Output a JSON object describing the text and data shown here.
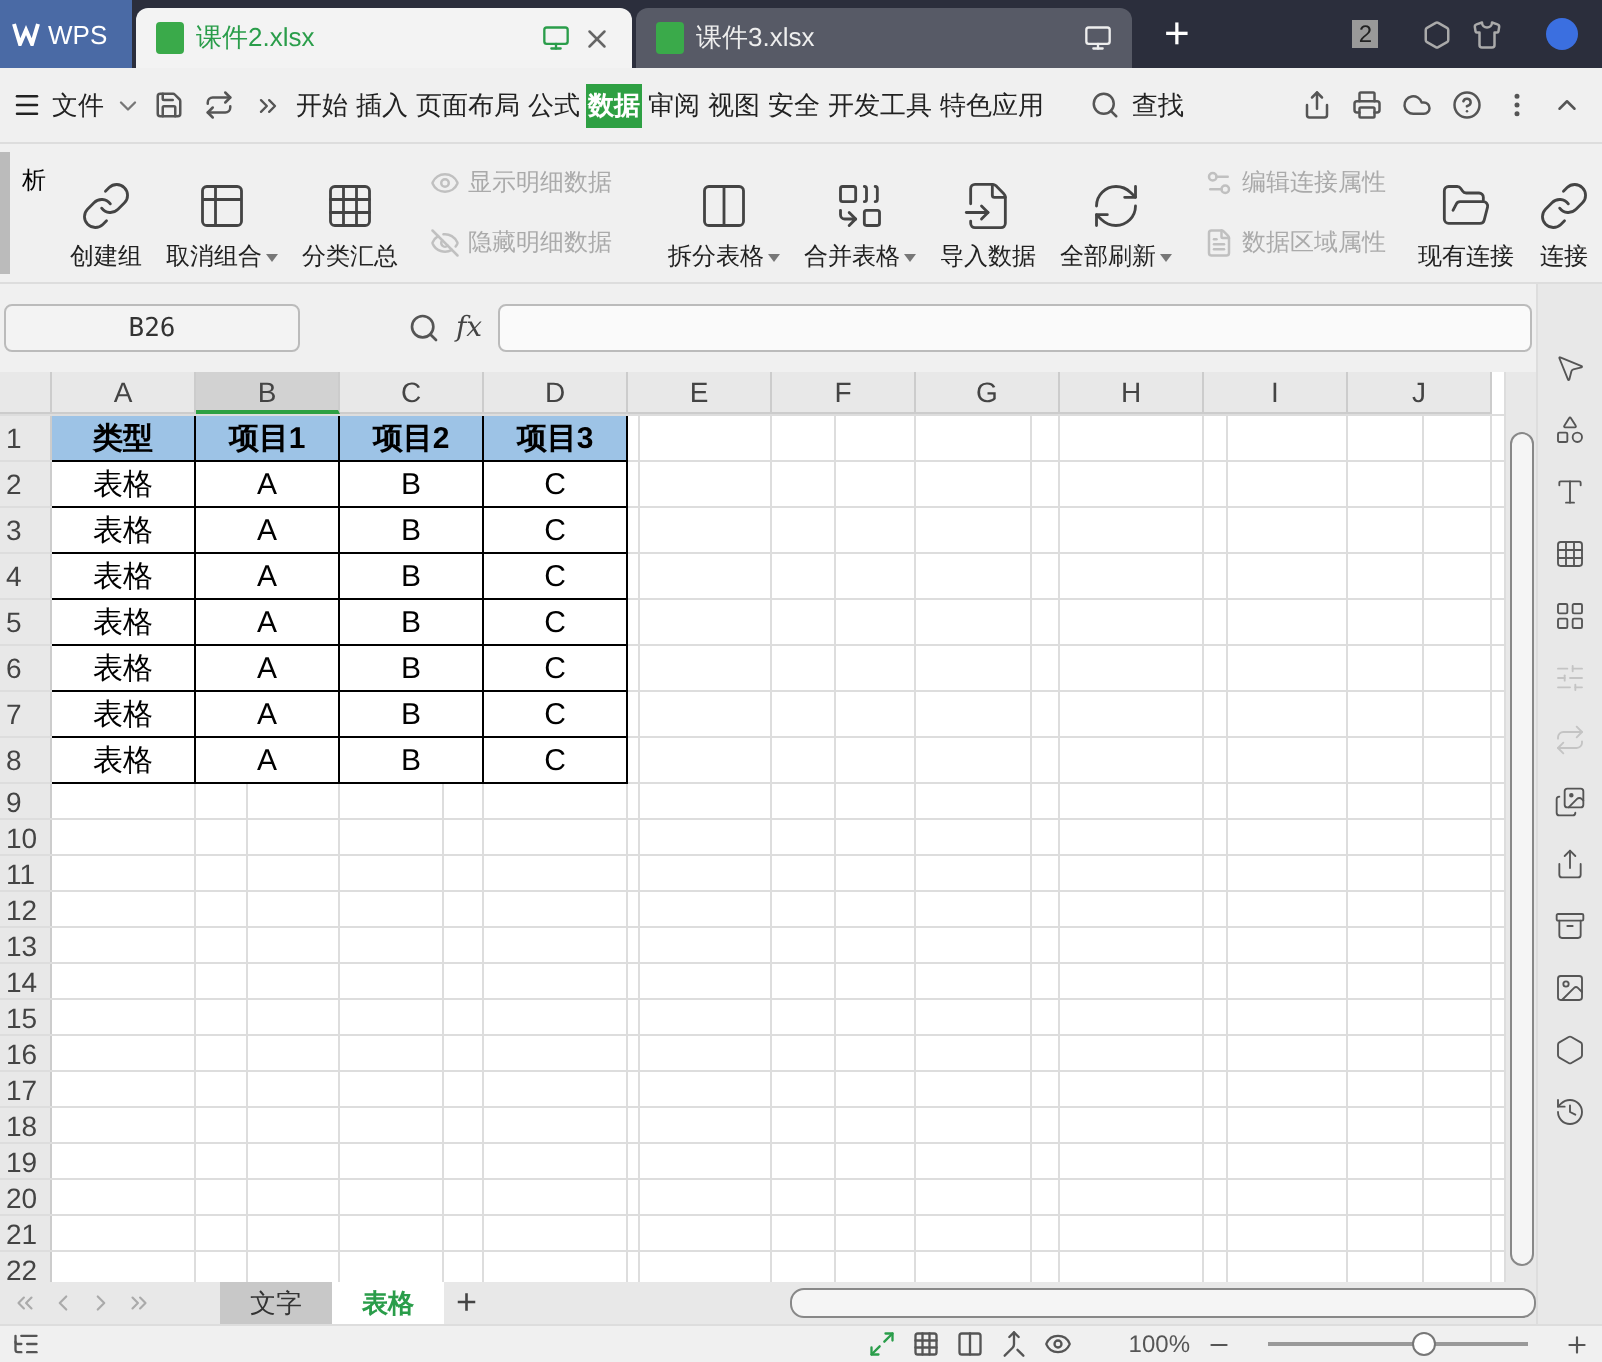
{
  "title_bar": {
    "app_tab": "WPS",
    "doc_tabs": [
      {
        "name": "课件2.xlsx",
        "selected": true
      },
      {
        "name": "课件3.xlsx",
        "selected": false
      }
    ],
    "new_tab": "+",
    "window_count": "2"
  },
  "menu": {
    "file": "文件",
    "tabs": [
      {
        "label": "开始",
        "selected": false
      },
      {
        "label": "插入",
        "selected": false
      },
      {
        "label": "页面布局",
        "selected": false
      },
      {
        "label": "公式",
        "selected": false
      },
      {
        "label": "数据",
        "selected": true
      },
      {
        "label": "审阅",
        "selected": false
      },
      {
        "label": "视图",
        "selected": false
      },
      {
        "label": "安全",
        "selected": false
      },
      {
        "label": "开发工具",
        "selected": false
      },
      {
        "label": "特色应用",
        "selected": false
      }
    ],
    "search": "查找"
  },
  "ribbon": {
    "cut_label": "析",
    "items": [
      {
        "kind": "large",
        "label": "创建组",
        "dropdown": false,
        "disabled": false
      },
      {
        "kind": "large",
        "label": "取消组合",
        "dropdown": true,
        "disabled": false
      },
      {
        "kind": "large",
        "label": "分类汇总",
        "dropdown": false,
        "disabled": false
      },
      {
        "kind": "stack",
        "entries": [
          {
            "label": "显示明细数据",
            "disabled": true
          },
          {
            "label": "隐藏明细数据",
            "disabled": true
          }
        ]
      },
      {
        "kind": "separator"
      },
      {
        "kind": "large",
        "label": "拆分表格",
        "dropdown": true,
        "disabled": false
      },
      {
        "kind": "large",
        "label": "合并表格",
        "dropdown": true,
        "disabled": false
      },
      {
        "kind": "large",
        "label": "导入数据",
        "dropdown": false,
        "disabled": false
      },
      {
        "kind": "large",
        "label": "全部刷新",
        "dropdown": true,
        "disabled": false
      },
      {
        "kind": "stack",
        "entries": [
          {
            "label": "编辑连接属性",
            "disabled": true
          },
          {
            "label": "数据区域属性",
            "disabled": true
          }
        ]
      },
      {
        "kind": "large",
        "label": "现有连接",
        "dropdown": false,
        "disabled": false
      },
      {
        "kind": "large",
        "label": "连接",
        "dropdown": false,
        "disabled": false
      }
    ]
  },
  "formula_bar": {
    "cell_ref": "B26",
    "fx": "fx"
  },
  "sheet": {
    "columns": [
      {
        "label": "A",
        "selected": false
      },
      {
        "label": "B",
        "selected": true
      },
      {
        "label": "C",
        "selected": false
      },
      {
        "label": "D",
        "selected": false
      },
      {
        "label": "E",
        "selected": false
      },
      {
        "label": "F",
        "selected": false
      },
      {
        "label": "G",
        "selected": false
      },
      {
        "label": "H",
        "selected": false
      },
      {
        "label": "I",
        "selected": false
      },
      {
        "label": "J",
        "selected": false
      }
    ],
    "rows": [
      {
        "number": "1",
        "kind": "header",
        "cells": [
          "类型",
          "项目1",
          "项目2",
          "项目3"
        ]
      },
      {
        "number": "2",
        "kind": "data",
        "cells": [
          "表格",
          "A",
          "B",
          "C"
        ]
      },
      {
        "number": "3",
        "kind": "data",
        "cells": [
          "表格",
          "A",
          "B",
          "C"
        ]
      },
      {
        "number": "4",
        "kind": "data",
        "cells": [
          "表格",
          "A",
          "B",
          "C"
        ]
      },
      {
        "number": "5",
        "kind": "data",
        "cells": [
          "表格",
          "A",
          "B",
          "C"
        ]
      },
      {
        "number": "6",
        "kind": "data",
        "cells": [
          "表格",
          "A",
          "B",
          "C"
        ]
      },
      {
        "number": "7",
        "kind": "data",
        "cells": [
          "表格",
          "A",
          "B",
          "C"
        ]
      },
      {
        "number": "8",
        "kind": "data",
        "cells": [
          "表格",
          "A",
          "B",
          "C"
        ]
      },
      {
        "number": "9",
        "kind": "empty"
      },
      {
        "number": "10",
        "kind": "empty"
      },
      {
        "number": "11",
        "kind": "empty"
      },
      {
        "number": "12",
        "kind": "empty"
      },
      {
        "number": "13",
        "kind": "empty"
      },
      {
        "number": "14",
        "kind": "empty"
      },
      {
        "number": "15",
        "kind": "empty"
      },
      {
        "number": "16",
        "kind": "empty"
      },
      {
        "number": "17",
        "kind": "empty"
      },
      {
        "number": "18",
        "kind": "empty"
      },
      {
        "number": "19",
        "kind": "empty"
      },
      {
        "number": "20",
        "kind": "empty"
      },
      {
        "number": "21",
        "kind": "empty"
      },
      {
        "number": "22",
        "kind": "empty"
      }
    ]
  },
  "sidebar_tools": [
    {
      "disabled": false
    },
    {
      "disabled": false
    },
    {
      "disabled": false
    },
    {
      "disabled": false
    },
    {
      "disabled": false
    },
    {
      "disabled": true
    },
    {
      "disabled": true
    },
    {
      "disabled": false
    },
    {
      "disabled": false
    },
    {
      "disabled": false
    },
    {
      "disabled": false
    },
    {
      "disabled": false
    },
    {
      "disabled": false
    }
  ],
  "sheet_tabs": [
    {
      "label": "文字",
      "selected": false
    },
    {
      "label": "表格",
      "selected": true
    }
  ],
  "add_sheet": "+",
  "status_bar": {
    "zoom": "100%",
    "zoom_slider": {
      "level": 0.6
    }
  }
}
